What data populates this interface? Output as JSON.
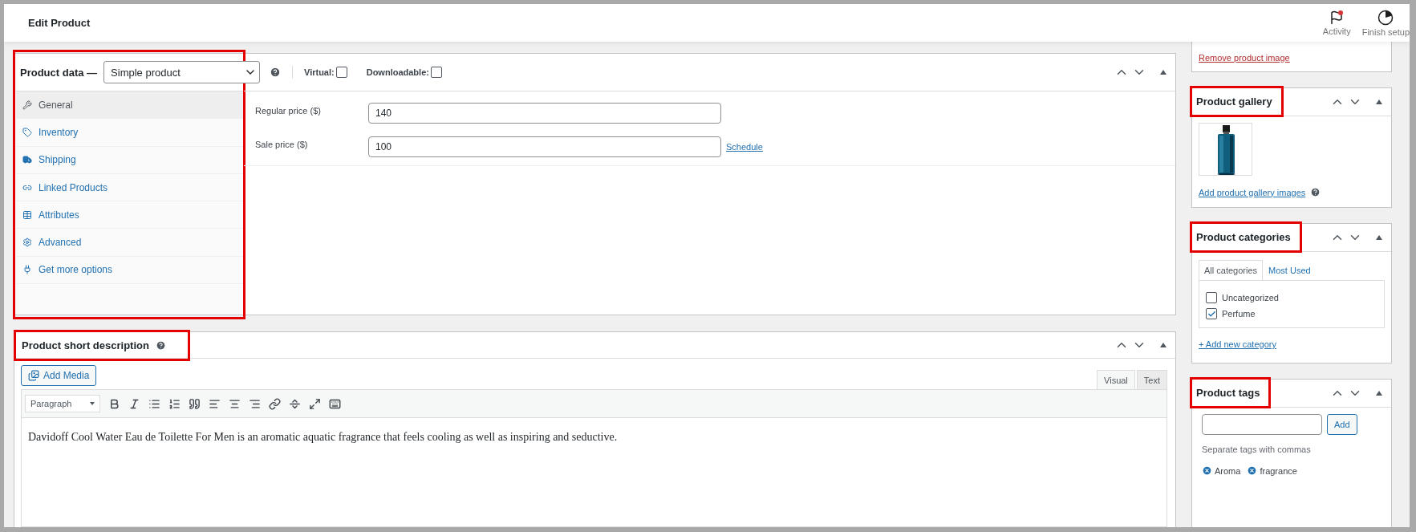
{
  "header": {
    "title": "Edit Product",
    "actions": [
      {
        "label": "Activity",
        "kind": "flag",
        "badge": true
      },
      {
        "label": "Finish setup",
        "kind": "progress"
      }
    ]
  },
  "product_data": {
    "highlighted": true,
    "title": "Product data —",
    "product_type": "Simple product",
    "options": [
      {
        "label": "Virtual:",
        "checked": false
      },
      {
        "label": "Downloadable:",
        "checked": false
      }
    ],
    "tabs": [
      {
        "label": "General",
        "selected": true
      },
      {
        "label": "Inventory",
        "selected": false
      },
      {
        "label": "Shipping",
        "selected": false
      },
      {
        "label": "Linked Products",
        "selected": false
      },
      {
        "label": "Attributes",
        "selected": false
      },
      {
        "label": "Advanced",
        "selected": false
      },
      {
        "label": "Get more options",
        "selected": false
      }
    ],
    "fields": [
      {
        "label": "Regular price ($)",
        "value": "140"
      },
      {
        "label": "Sale price ($)",
        "value": "100",
        "link": "Schedule"
      }
    ]
  },
  "short_description": {
    "highlighted": true,
    "title": "Product short description",
    "add_media": "Add Media",
    "format": "Paragraph",
    "editor_tabs": [
      {
        "label": "Visual",
        "selected": true
      },
      {
        "label": "Text",
        "selected": false
      }
    ],
    "content": "Davidoff Cool Water Eau de Toilette For Men is an aromatic aquatic fragrance that feels cooling as well as inspiring and seductive."
  },
  "sidebar": {
    "image_link": "Remove product image",
    "gallery": {
      "highlighted": true,
      "title": "Product gallery",
      "link": "Add product gallery images"
    },
    "categories": {
      "highlighted": true,
      "title": "Product categories",
      "tabs": [
        {
          "label": "All categories",
          "selected": true
        },
        {
          "label": "Most Used",
          "selected": false
        }
      ],
      "items": [
        {
          "label": "Uncategorized",
          "checked": false
        },
        {
          "label": "Perfume",
          "checked": true
        }
      ],
      "link": "+ Add new category"
    },
    "tags": {
      "highlighted": true,
      "title": "Product tags",
      "button": "Add",
      "hint": "Separate tags with commas",
      "tags": [
        "Aroma",
        "fragrance"
      ]
    }
  }
}
